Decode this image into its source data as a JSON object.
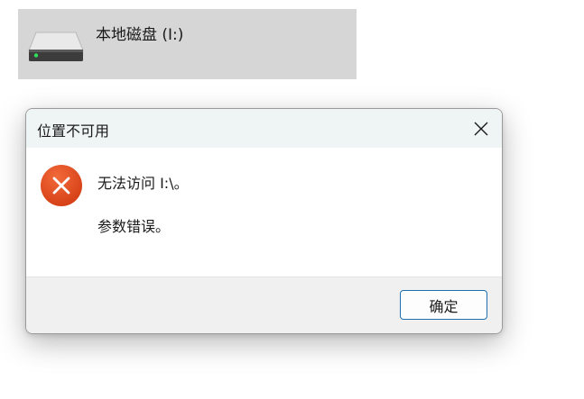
{
  "explorer": {
    "drive_label": "本地磁盘 (I:)",
    "drive_icon": "hard-drive-icon"
  },
  "dialog": {
    "title": "位置不可用",
    "close_icon": "close-icon",
    "error_icon": "error-icon",
    "message_line1": "无法访问 I:\\。",
    "message_line2": "参数错误。",
    "ok_label": "确定"
  },
  "colors": {
    "selection_bg": "#d6d6d6",
    "titlebar_bg": "#eff4f4",
    "error_red": "#e0451f",
    "button_border": "#1f6fb0",
    "footer_bg": "#f0f0f0"
  }
}
